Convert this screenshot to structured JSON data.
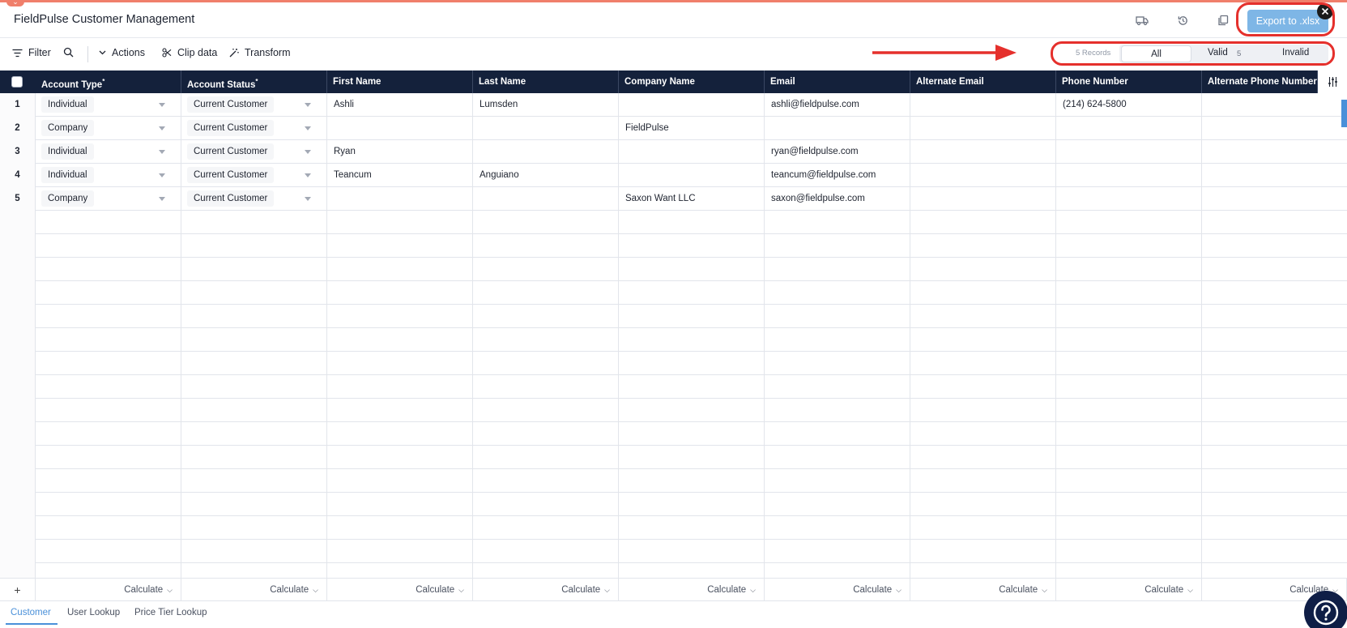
{
  "window": {
    "title": "FieldPulse Customer Management"
  },
  "header": {
    "export_label": "Export to .xlsx",
    "icons": [
      "truck-icon",
      "history-icon",
      "copy-icon"
    ]
  },
  "toolbar": {
    "filter_label": "Filter",
    "actions_label": "Actions",
    "clip_label": "Clip data",
    "transform_label": "Transform",
    "records_label": "5 Records",
    "seg_all": "All",
    "seg_valid": "Valid",
    "seg_valid_count": "5",
    "seg_invalid": "Invalid"
  },
  "columns": [
    {
      "label": "Account Type",
      "required": true
    },
    {
      "label": "Account Status",
      "required": true
    },
    {
      "label": "First Name",
      "required": false
    },
    {
      "label": "Last Name",
      "required": false
    },
    {
      "label": "Company Name",
      "required": false
    },
    {
      "label": "Email",
      "required": false
    },
    {
      "label": "Alternate Email",
      "required": false
    },
    {
      "label": "Phone Number",
      "required": false
    },
    {
      "label": "Alternate Phone Number",
      "required": false
    }
  ],
  "rows": [
    {
      "num": "1",
      "cells": [
        "Individual",
        "Current Customer",
        "Ashli",
        "Lumsden",
        "",
        "ashli@fieldpulse.com",
        "",
        "(214) 624-5800",
        ""
      ]
    },
    {
      "num": "2",
      "cells": [
        "Company",
        "Current Customer",
        "",
        "",
        "FieldPulse",
        "",
        "",
        "",
        ""
      ]
    },
    {
      "num": "3",
      "cells": [
        "Individual",
        "Current Customer",
        "Ryan",
        "",
        "",
        "ryan@fieldpulse.com",
        "",
        "",
        ""
      ]
    },
    {
      "num": "4",
      "cells": [
        "Individual",
        "Current Customer",
        "Teancum",
        "Anguiano",
        "",
        "teancum@fieldpulse.com",
        "",
        "",
        ""
      ]
    },
    {
      "num": "5",
      "cells": [
        "Company",
        "Current Customer",
        "",
        "",
        "Saxon Want LLC",
        "saxon@fieldpulse.com",
        "",
        "",
        ""
      ]
    }
  ],
  "footer": {
    "calc_label": "Calculate",
    "tabs": [
      "Customer",
      "User Lookup",
      "Price Tier Lookup"
    ]
  },
  "colors": {
    "header_bg": "#14213b",
    "export_btn": "#7eb6e6",
    "highlight": "#e5302c",
    "accent": "#4a90d9"
  }
}
